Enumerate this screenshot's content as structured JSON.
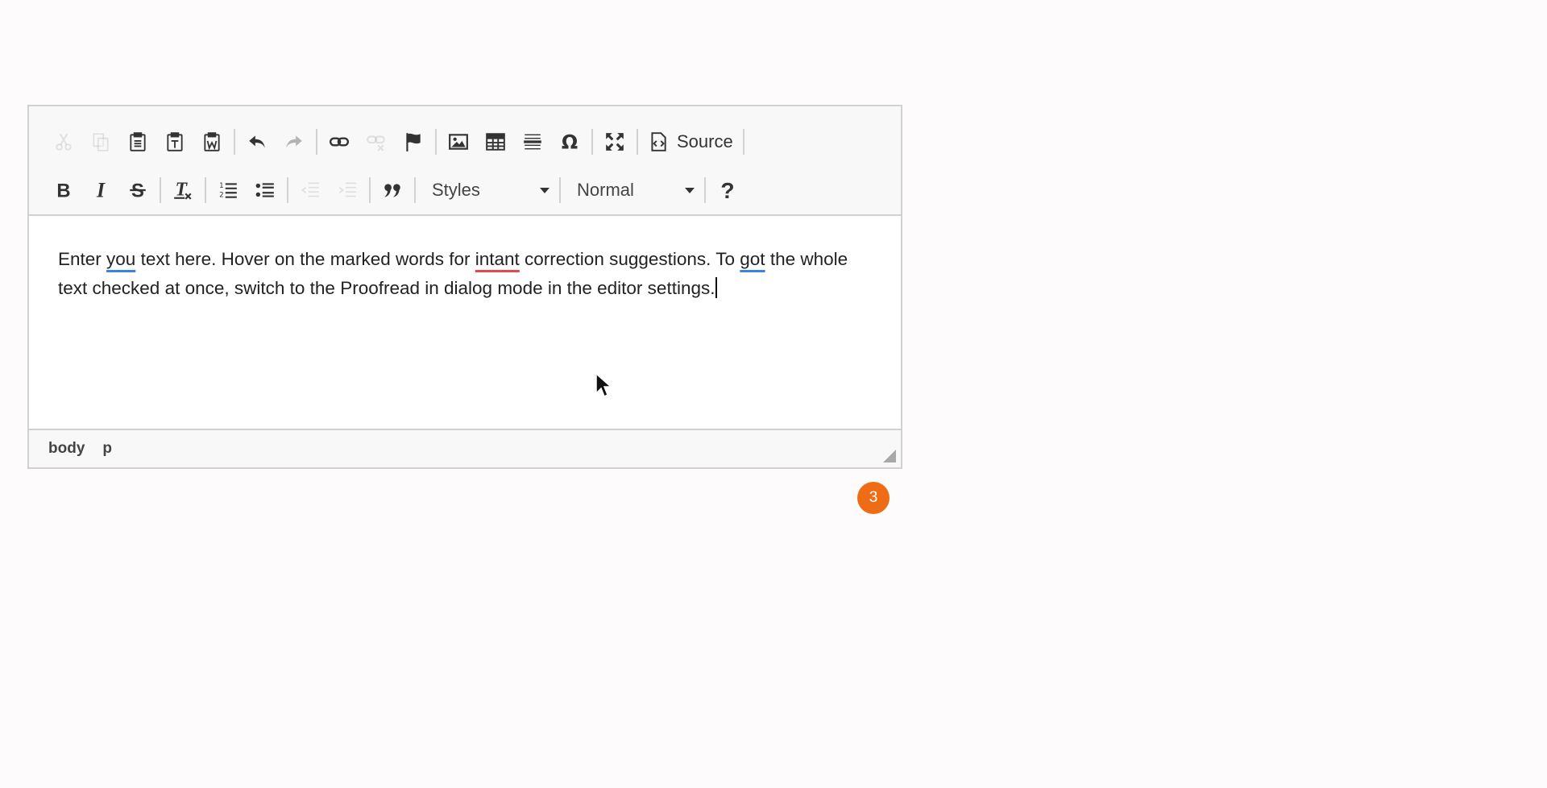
{
  "toolbar": {
    "row1": [
      {
        "name": "cut-button",
        "icon": "scissors-icon",
        "enabled": false
      },
      {
        "name": "copy-button",
        "icon": "copy-icon",
        "enabled": false
      },
      {
        "name": "paste-button",
        "icon": "clipboard-icon",
        "enabled": true
      },
      {
        "name": "paste-text-button",
        "icon": "clipboard-text-icon",
        "enabled": true
      },
      {
        "name": "paste-word-button",
        "icon": "clipboard-word-icon",
        "enabled": true
      },
      {
        "name": "undo-button",
        "icon": "undo-icon",
        "enabled": true
      },
      {
        "name": "redo-button",
        "icon": "redo-icon",
        "enabled": false
      },
      {
        "name": "link-button",
        "icon": "link-icon",
        "enabled": true
      },
      {
        "name": "unlink-button",
        "icon": "unlink-icon",
        "enabled": false
      },
      {
        "name": "anchor-button",
        "icon": "flag-icon",
        "enabled": true
      },
      {
        "name": "image-button",
        "icon": "image-icon",
        "enabled": true
      },
      {
        "name": "table-button",
        "icon": "table-icon",
        "enabled": true
      },
      {
        "name": "horizontal-line-button",
        "icon": "horizontal-line-icon",
        "enabled": true
      },
      {
        "name": "special-char-button",
        "icon": "omega-icon",
        "enabled": true
      },
      {
        "name": "maximize-button",
        "icon": "maximize-icon",
        "enabled": true
      }
    ],
    "source_label": "Source",
    "row2": [
      {
        "name": "bold-button",
        "icon": "bold-icon",
        "enabled": true
      },
      {
        "name": "italic-button",
        "icon": "italic-icon",
        "enabled": true
      },
      {
        "name": "strike-button",
        "icon": "strikethrough-icon",
        "enabled": true
      },
      {
        "name": "remove-format-button",
        "icon": "remove-format-icon",
        "enabled": true
      },
      {
        "name": "numbered-list-button",
        "icon": "numbered-list-icon",
        "enabled": true
      },
      {
        "name": "bulleted-list-button",
        "icon": "bulleted-list-icon",
        "enabled": true
      },
      {
        "name": "outdent-button",
        "icon": "outdent-icon",
        "enabled": false
      },
      {
        "name": "indent-button",
        "icon": "indent-icon",
        "enabled": false
      },
      {
        "name": "blockquote-button",
        "icon": "quote-icon",
        "enabled": true
      }
    ],
    "styles_label": "Styles",
    "format_label": "Normal",
    "help_icon": "question-icon"
  },
  "content": {
    "part1": "Enter ",
    "mark1": "you",
    "part2": " text here. Hover on the marked words for ",
    "mark2": "intant",
    "part3": " correction suggestions. To ",
    "mark3": "got",
    "part4": " the whole text checked at once, switch to the Proofread in dialog mode in the editor settings."
  },
  "badge_count": "3",
  "statusbar": {
    "crumb1": "body",
    "crumb2": "p"
  },
  "colors": {
    "badge": "#ef6c16",
    "grammar_mark": "#3b82e6",
    "spelling_mark": "#e5484d"
  }
}
